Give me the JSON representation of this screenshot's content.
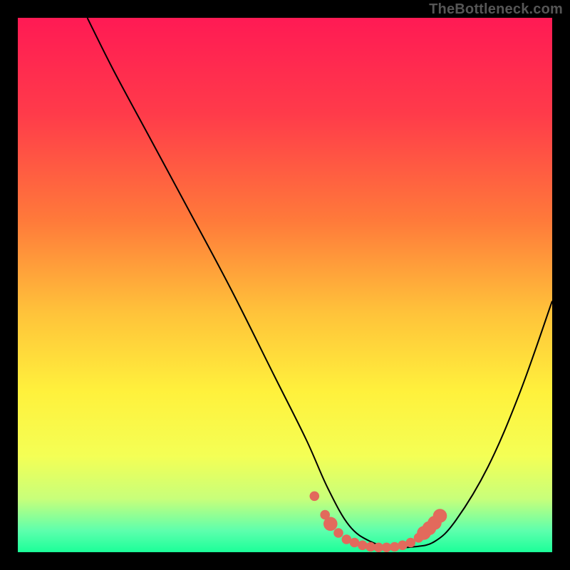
{
  "attribution": "TheBottleneck.com",
  "chart_data": {
    "type": "line",
    "title": "",
    "xlabel": "",
    "ylabel": "",
    "xlim": [
      0,
      100
    ],
    "ylim": [
      0,
      100
    ],
    "gradient_stops": [
      {
        "offset": 0,
        "color": "#ff1a54"
      },
      {
        "offset": 18,
        "color": "#ff3b4a"
      },
      {
        "offset": 38,
        "color": "#ff7a3a"
      },
      {
        "offset": 55,
        "color": "#ffc23a"
      },
      {
        "offset": 70,
        "color": "#fff13c"
      },
      {
        "offset": 82,
        "color": "#f4ff55"
      },
      {
        "offset": 90,
        "color": "#c8ff7a"
      },
      {
        "offset": 96,
        "color": "#5dffad"
      },
      {
        "offset": 100,
        "color": "#1bff99"
      }
    ],
    "series": [
      {
        "name": "bottleneck-curve",
        "x": [
          13,
          18,
          25,
          32,
          40,
          48,
          54,
          58,
          62,
          66,
          70,
          74,
          78,
          82,
          88,
          94,
          100
        ],
        "y": [
          100,
          90,
          77,
          64,
          49,
          33,
          21,
          12,
          5,
          2,
          1,
          1,
          2,
          6,
          16,
          30,
          47
        ]
      }
    ],
    "markers": {
      "name": "highlight-dots",
      "color": "#e26a5c",
      "points": [
        {
          "x": 55.5,
          "y": 10.5,
          "r": 0.9
        },
        {
          "x": 57.5,
          "y": 7.0,
          "r": 0.9
        },
        {
          "x": 58.5,
          "y": 5.3,
          "r": 1.3
        },
        {
          "x": 60.0,
          "y": 3.6,
          "r": 0.9
        },
        {
          "x": 61.5,
          "y": 2.4,
          "r": 0.9
        },
        {
          "x": 63.0,
          "y": 1.8,
          "r": 0.9
        },
        {
          "x": 64.5,
          "y": 1.3,
          "r": 0.9
        },
        {
          "x": 66.0,
          "y": 1.0,
          "r": 0.9
        },
        {
          "x": 67.5,
          "y": 0.9,
          "r": 0.9
        },
        {
          "x": 69.0,
          "y": 0.9,
          "r": 0.9
        },
        {
          "x": 70.5,
          "y": 1.0,
          "r": 0.9
        },
        {
          "x": 72.0,
          "y": 1.3,
          "r": 0.9
        },
        {
          "x": 73.5,
          "y": 1.8,
          "r": 0.9
        },
        {
          "x": 75.0,
          "y": 2.7,
          "r": 0.9
        },
        {
          "x": 76.0,
          "y": 3.6,
          "r": 1.3
        },
        {
          "x": 77.0,
          "y": 4.5,
          "r": 1.3
        },
        {
          "x": 78.0,
          "y": 5.5,
          "r": 1.3
        },
        {
          "x": 79.0,
          "y": 6.8,
          "r": 1.3
        }
      ]
    }
  }
}
